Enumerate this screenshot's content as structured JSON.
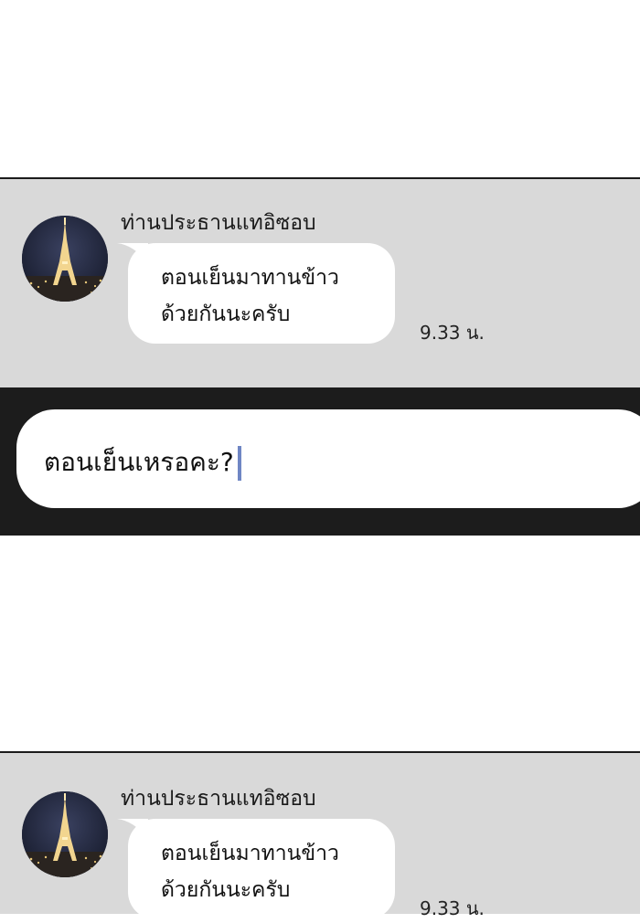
{
  "messages": [
    {
      "sender": "ท่านประธานแทอิซอบ",
      "lines": [
        "ตอนเย็นมาทานข้าว",
        "ด้วยกันนะครับ"
      ],
      "time": "9.33 น.",
      "avatar_icon": "eiffel-tower-night-photo"
    },
    {
      "sender": "ท่านประธานแทอิซอบ",
      "lines": [
        "ตอนเย็นมาทานข้าว",
        "ด้วยกันนะครับ"
      ],
      "time": "9.33 น.",
      "avatar_icon": "eiffel-tower-night-photo"
    }
  ],
  "input": {
    "value": "ตอนเย็นเหรอคะ?"
  },
  "colors": {
    "panel_bg": "#d9d9d9",
    "input_strip_bg": "#1c1c1c",
    "bubble_bg": "#ffffff",
    "caret": "#6f86c4"
  }
}
